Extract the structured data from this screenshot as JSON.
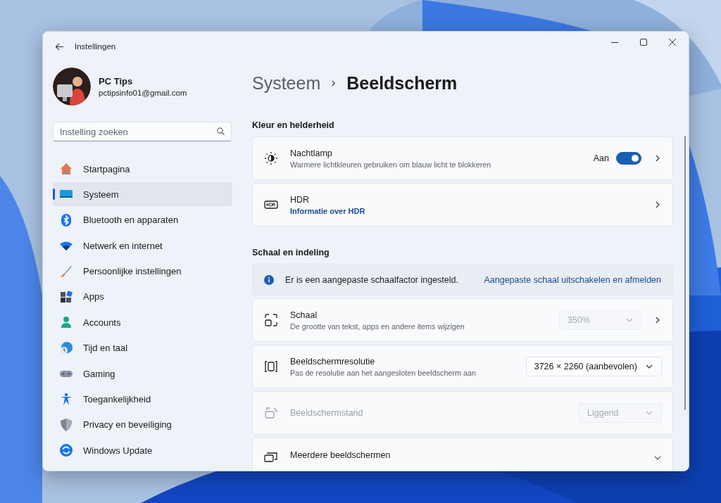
{
  "window": {
    "title": "Instellingen"
  },
  "account": {
    "name": "PC Tips",
    "email": "pctipsinfo01@gmail.com"
  },
  "search": {
    "placeholder": "Instelling zoeken"
  },
  "nav": [
    {
      "label": "Startpagina",
      "selected": false
    },
    {
      "label": "Systeem",
      "selected": true
    },
    {
      "label": "Bluetooth en apparaten",
      "selected": false
    },
    {
      "label": "Netwerk en internet",
      "selected": false
    },
    {
      "label": "Persoonlijke instellingen",
      "selected": false
    },
    {
      "label": "Apps",
      "selected": false
    },
    {
      "label": "Accounts",
      "selected": false
    },
    {
      "label": "Tijd en taal",
      "selected": false
    },
    {
      "label": "Gaming",
      "selected": false
    },
    {
      "label": "Toegankelijkheid",
      "selected": false
    },
    {
      "label": "Privacy en beveiliging",
      "selected": false
    },
    {
      "label": "Windows Update",
      "selected": false
    }
  ],
  "breadcrumb": [
    "Systeem",
    "Beeldscherm"
  ],
  "sections": [
    {
      "title": "Kleur en helderheid",
      "items": [
        {
          "kind": "toggle",
          "title": "Nachtlamp",
          "subtitle": "Warmere lichtkleuren gebruiken om blauw licht te blokkeren",
          "state_label": "Aan",
          "on": true,
          "chevron": true
        },
        {
          "kind": "link",
          "title": "HDR",
          "link": "Informatie over HDR",
          "chevron": true
        }
      ]
    },
    {
      "title": "Schaal en indeling",
      "items": [
        {
          "kind": "info",
          "text": "Er is een aangepaste schaalfactor ingesteld.",
          "link": "Aangepaste schaal uitschakelen en afmelden"
        },
        {
          "kind": "dropdown",
          "title": "Schaal",
          "subtitle": "De grootte van tekst, apps en andere items wijzigen",
          "value": "350%",
          "disabled": true,
          "chevron": true
        },
        {
          "kind": "dropdown",
          "title": "Beeldschermresolutie",
          "subtitle": "Pas de resolutie aan het aangesloten beeldscherm aan",
          "value": "3726 × 2260 (aanbevolen)",
          "disabled": false,
          "chevron": false
        },
        {
          "kind": "dropdown",
          "title": "Beeldschermstand",
          "value": "Liggend",
          "disabled": true,
          "chevron": false
        },
        {
          "kind": "expander",
          "title": "Meerdere beeldschermen"
        }
      ]
    }
  ]
}
